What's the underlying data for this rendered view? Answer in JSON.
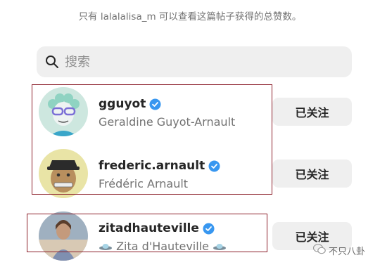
{
  "notice": "只有 lalalalisa_m 可以查看这篇帖子获得的总赞数。",
  "search": {
    "placeholder": "搜索"
  },
  "colors": {
    "verified": "#3897f0",
    "button_bg": "#efefef",
    "highlight_border": "#8c1f2a"
  },
  "users": [
    {
      "username": "gguyot",
      "full_name": "Geraldine Guyot-Arnault",
      "verified": true,
      "button": "已关注"
    },
    {
      "username": "frederic.arnault",
      "full_name": "Frédéric Arnault",
      "verified": true,
      "button": "已关注"
    },
    {
      "username": "zitadhauteville",
      "full_name": "Zita d'Hauteville",
      "name_decoration": "ufo-icon",
      "verified": true,
      "button": "已关注"
    }
  ],
  "watermark": "不只八卦"
}
